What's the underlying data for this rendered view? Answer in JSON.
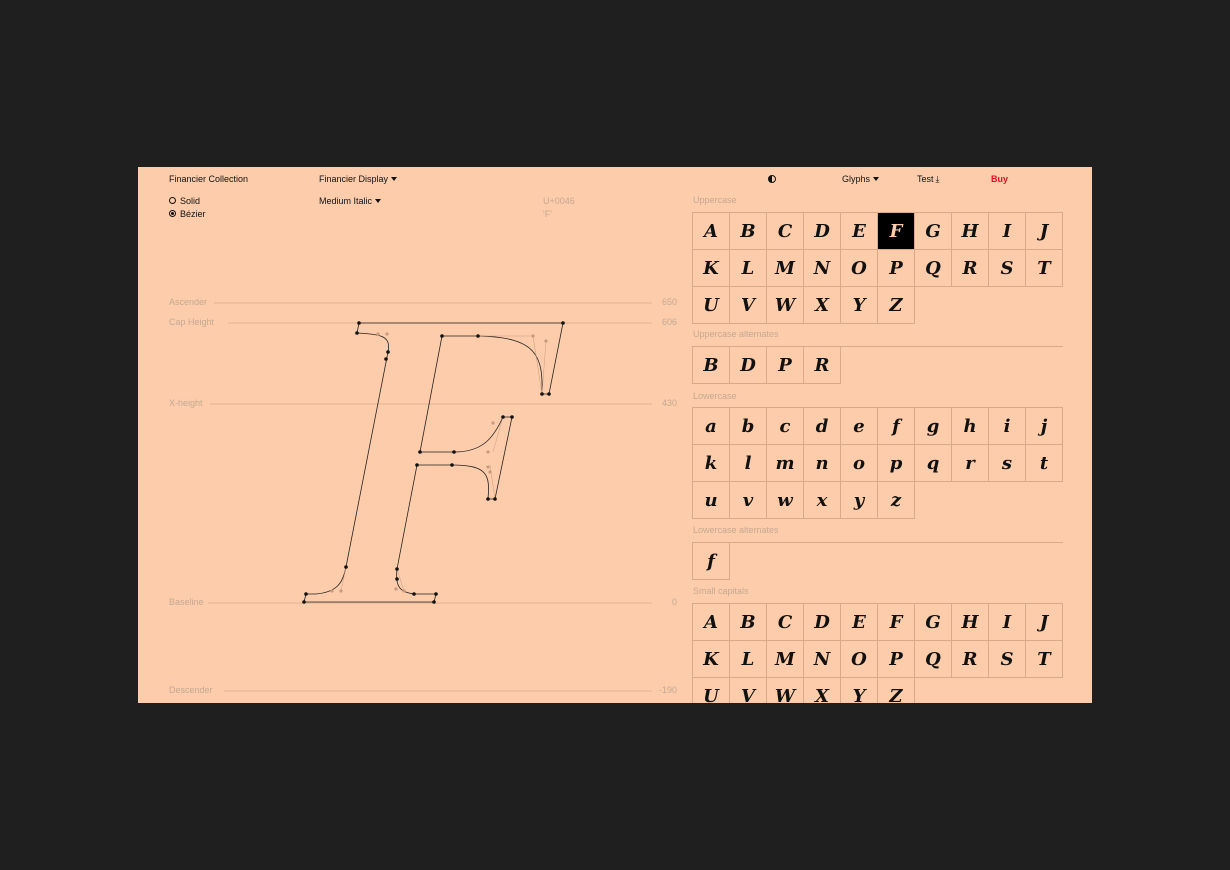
{
  "topbar": {
    "collection": "Financier Collection",
    "family": "Financier Display",
    "view": "Glyphs",
    "test": "Test",
    "buy": "Buy",
    "brand_color": "#e0101f"
  },
  "options": {
    "render_modes": [
      {
        "label": "Solid",
        "selected": false
      },
      {
        "label": "Bézier",
        "selected": true
      }
    ],
    "style": "Medium Italic"
  },
  "glyph_info": {
    "unicode": "U+0046",
    "character": "'F'"
  },
  "metrics": [
    {
      "label": "Ascender",
      "value": "650"
    },
    {
      "label": "Cap Height",
      "value": "606"
    },
    {
      "label": "X-height",
      "value": "430"
    },
    {
      "label": "Baseline",
      "value": "0"
    },
    {
      "label": "Descender",
      "value": "-190"
    }
  ],
  "glyph_sections": [
    {
      "title": "Uppercase",
      "glyphs": [
        "A",
        "B",
        "C",
        "D",
        "E",
        "F",
        "G",
        "H",
        "I",
        "J",
        "K",
        "L",
        "M",
        "N",
        "O",
        "P",
        "Q",
        "R",
        "S",
        "T",
        "U",
        "V",
        "W",
        "X",
        "Y",
        "Z"
      ],
      "selected": "F"
    },
    {
      "title": "Uppercase alternates",
      "glyphs": [
        "B",
        "D",
        "P",
        "R"
      ]
    },
    {
      "title": "Lowercase",
      "glyphs": [
        "a",
        "b",
        "c",
        "d",
        "e",
        "f",
        "g",
        "h",
        "i",
        "j",
        "k",
        "l",
        "m",
        "n",
        "o",
        "p",
        "q",
        "r",
        "s",
        "t",
        "u",
        "v",
        "w",
        "x",
        "y",
        "z"
      ]
    },
    {
      "title": "Lowercase alternates",
      "glyphs": [
        "f"
      ]
    },
    {
      "title": "Small capitals",
      "glyphs": [
        "A",
        "B",
        "C",
        "D",
        "E",
        "F",
        "G",
        "H",
        "I",
        "J",
        "K",
        "L",
        "M",
        "N",
        "O",
        "P",
        "Q",
        "R",
        "S",
        "T",
        "U",
        "V",
        "W",
        "X",
        "Y",
        "Z"
      ]
    }
  ]
}
